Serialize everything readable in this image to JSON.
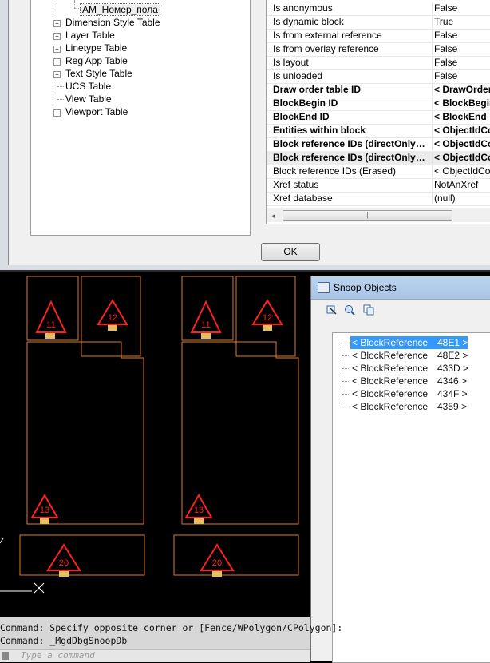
{
  "tree": {
    "items": [
      {
        "label": "АМ_Номер_пола",
        "expandable": false,
        "selected": true
      },
      {
        "label": "Dimension Style Table",
        "expandable": true
      },
      {
        "label": "Layer Table",
        "expandable": true
      },
      {
        "label": "Linetype Table",
        "expandable": true
      },
      {
        "label": "Reg App Table",
        "expandable": true
      },
      {
        "label": "Text Style Table",
        "expandable": true
      },
      {
        "label": "UCS Table",
        "expandable": false
      },
      {
        "label": "View Table",
        "expandable": false
      },
      {
        "label": "Viewport Table",
        "expandable": true
      }
    ]
  },
  "properties": {
    "rows": [
      {
        "name": "Is anonymous",
        "value": "False",
        "bold": false
      },
      {
        "name": "Is dynamic block",
        "value": "True",
        "bold": false
      },
      {
        "name": "Is from external reference",
        "value": "False",
        "bold": false
      },
      {
        "name": "Is from overlay reference",
        "value": "False",
        "bold": false
      },
      {
        "name": "Is layout",
        "value": "False",
        "bold": false
      },
      {
        "name": "Is unloaded",
        "value": "False",
        "bold": false
      },
      {
        "name": "Draw order table ID",
        "value": "< DrawOrderTable",
        "bold": true
      },
      {
        "name": "BlockBegin ID",
        "value": "< BlockBegin",
        "bold": true
      },
      {
        "name": "BlockEnd ID",
        "value": "< BlockEnd",
        "bold": true
      },
      {
        "name": "Entities within block",
        "value": "< ObjectIdCollection",
        "bold": true
      },
      {
        "name": "Block reference IDs (directOnly = true)",
        "value": "< ObjectIdCollection",
        "bold": true
      },
      {
        "name": "Block reference IDs (directOnly = false)",
        "value": "< ObjectIdCollection",
        "bold": true
      },
      {
        "name": "Block reference IDs (Erased)",
        "value": "< ObjectIdCollection",
        "bold": false
      },
      {
        "name": "Xref status",
        "value": "NotAnXref",
        "bold": false
      },
      {
        "name": "Xref database",
        "value": "(null)",
        "bold": false
      }
    ]
  },
  "scrollbar": {
    "left_arrow": "◂",
    "grip": "|||"
  },
  "dialog": {
    "ok_label": "OK"
  },
  "snoop": {
    "title": "Snoop Objects",
    "items": [
      {
        "label": "< BlockReference",
        "handle": "48E1 >",
        "selected": true
      },
      {
        "label": "< BlockReference",
        "handle": "48E2 >",
        "selected": false
      },
      {
        "label": "< BlockReference",
        "handle": "433D >",
        "selected": false
      },
      {
        "label": "< BlockReference",
        "handle": "4346 >",
        "selected": false
      },
      {
        "label": "< BlockReference",
        "handle": "434F >",
        "selected": false
      },
      {
        "label": "< BlockReference",
        "handle": "4359 >",
        "selected": false
      }
    ]
  },
  "drawing": {
    "labels": [
      "11",
      "12",
      "13",
      "20"
    ]
  },
  "command": {
    "line1": "Command: Specify opposite corner or [Fence/WPolygon/CPolygon]:",
    "line2": "Command: _MgdDbgSnoopDb",
    "placeholder": "Type a command"
  },
  "colors": {
    "cad_orange": "#e07a1f",
    "cad_red": "#ff2020",
    "selection_blue": "#3399ff"
  }
}
